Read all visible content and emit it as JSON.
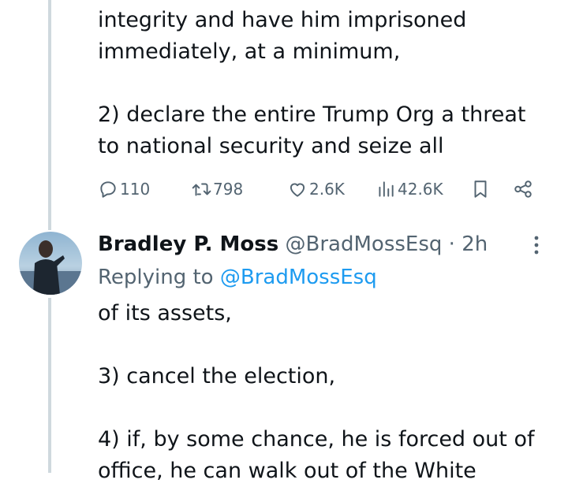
{
  "tweet1": {
    "body_top": "integrity and have him imprisoned\nimmediately, at a minimum,",
    "body_bottom": "2) declare the entire Trump Org a threat\nto national security and seize all",
    "stats": {
      "replies": "110",
      "retweets": "798",
      "likes": "2.6K",
      "views": "42.6K"
    }
  },
  "tweet2": {
    "author_name": "Bradley P. Moss",
    "author_handle": "@BradMossEsq",
    "separator": "·",
    "time": "2h",
    "replying_prefix": "Replying to",
    "replying_to": "@BradMossEsq",
    "body": "of its assets,\n\n3) cancel the election,\n\n4) if, by some chance, he is forced out of\noffice, he can walk out of the White"
  },
  "colors": {
    "text": "#0f1419",
    "secondary": "#536471",
    "link": "#1d9bf0",
    "thread_line": "#cfd9de"
  },
  "icons": [
    "reply-icon",
    "retweet-icon",
    "like-icon",
    "views-icon",
    "bookmark-icon",
    "share-icon",
    "more-icon"
  ]
}
